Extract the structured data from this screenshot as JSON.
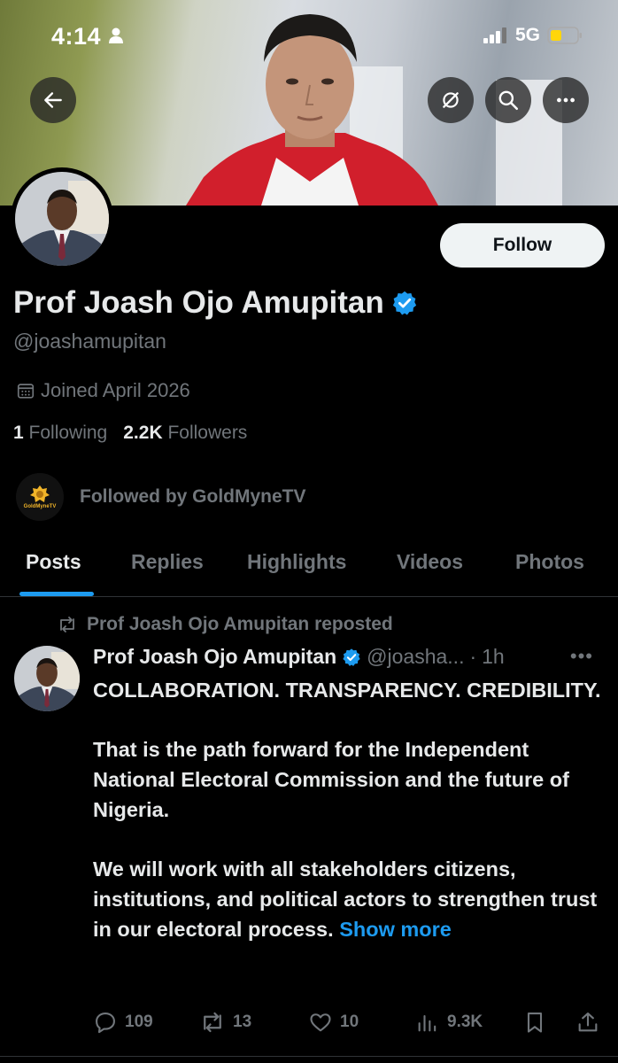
{
  "status_bar": {
    "time": "4:14",
    "network": "5G"
  },
  "profile": {
    "name": "Prof Joash Ojo Amupitan",
    "handle": "@joashamupitan",
    "joined": "Joined April 2026",
    "following_count": "1",
    "following_label": "Following",
    "followers_count": "2.2K",
    "followers_label": "Followers",
    "followed_by": "Followed by GoldMyneTV",
    "followed_by_logo_text": "GoldMyneTV",
    "follow_button": "Follow",
    "verified_color": "#1d9bf0"
  },
  "header_buttons": [
    "back-icon",
    "grok-icon",
    "search-icon",
    "more-icon"
  ],
  "tabs": [
    {
      "label": "Posts",
      "active": true
    },
    {
      "label": "Replies",
      "active": false
    },
    {
      "label": "Highlights",
      "active": false
    },
    {
      "label": "Videos",
      "active": false
    },
    {
      "label": "Photos",
      "active": false
    }
  ],
  "post": {
    "repost_label": "Prof Joash Ojo Amupitan reposted",
    "author": "Prof Joash Ojo Amupitan",
    "handle": "@joasha...",
    "time": "1h",
    "paragraphs": [
      "COLLABORATION. TRANSPARENCY. CREDIBILITY.",
      "That is the path forward for the Independent National Electoral Commission and the future of Nigeria.",
      "We will work with all stakeholders citizens, institutions, and political actors to strengthen trust in our electoral process."
    ],
    "show_more": "Show more",
    "replies": "109",
    "reposts": "13",
    "likes": "10",
    "views": "9.3K"
  },
  "colors": {
    "accent": "#1d9bf0",
    "muted": "#71767b",
    "text": "#e7e9ea",
    "background": "#000000"
  }
}
